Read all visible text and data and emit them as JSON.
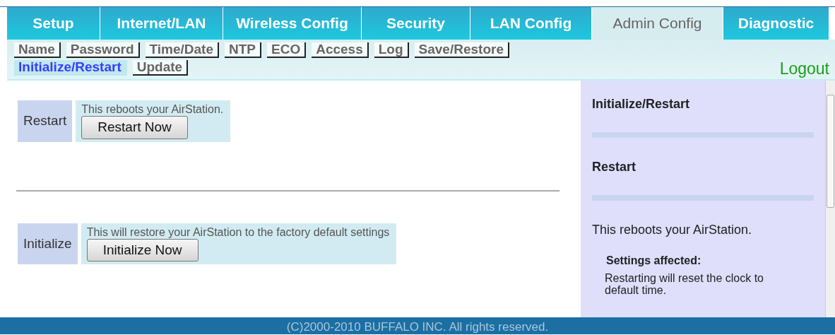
{
  "main_tabs": [
    {
      "label": "Setup",
      "selected": false
    },
    {
      "label": "Internet/LAN",
      "selected": false
    },
    {
      "label": "Wireless Config",
      "selected": false
    },
    {
      "label": "Security",
      "selected": false
    },
    {
      "label": "LAN Config",
      "selected": false
    },
    {
      "label": "Admin Config",
      "selected": true
    },
    {
      "label": "Diagnostic",
      "selected": false
    }
  ],
  "sub_tabs": [
    [
      {
        "label": "Name",
        "selected": false
      },
      {
        "label": "Password",
        "selected": false
      },
      {
        "label": "Time/Date",
        "selected": false
      },
      {
        "label": "NTP",
        "selected": false
      },
      {
        "label": "ECO",
        "selected": false
      },
      {
        "label": "Access",
        "selected": false
      },
      {
        "label": "Log",
        "selected": false
      },
      {
        "label": "Save/Restore",
        "selected": false
      }
    ],
    [
      {
        "label": "Initialize/Restart",
        "selected": true
      },
      {
        "label": "Update",
        "selected": false
      }
    ]
  ],
  "logout": "Logout",
  "sections": [
    {
      "label": "Restart",
      "description": "This reboots your AirStation.",
      "button": "Restart Now"
    },
    {
      "label": "Initialize",
      "description": "This will restore your AirStation to the factory default settings",
      "button": "Initialize Now"
    }
  ],
  "help": {
    "title": "Initialize/Restart",
    "section_title": "Restart",
    "text": "This reboots your AirStation.",
    "note_title": "Settings affected:",
    "note_text": "Restarting will reset the clock to default time."
  },
  "footer": "(C)2000-2010 BUFFALO INC. All rights reserved."
}
